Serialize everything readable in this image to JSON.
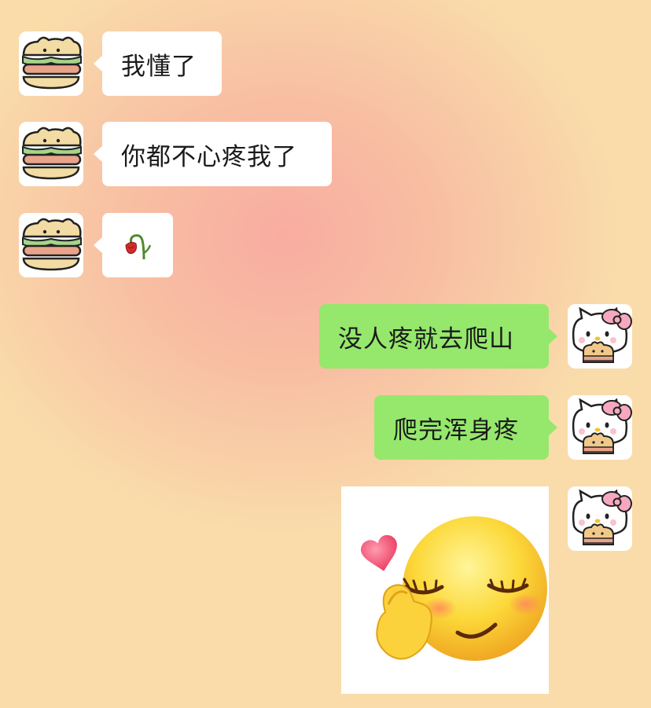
{
  "messages": [
    {
      "side": "left",
      "text": "我懂了",
      "avatar": "bear-sandwich-avatar"
    },
    {
      "side": "left",
      "text": "你都不心疼我了",
      "avatar": "bear-sandwich-avatar"
    },
    {
      "side": "left",
      "emoji": "🥀",
      "avatar": "bear-sandwich-avatar"
    },
    {
      "side": "right",
      "text": "没人疼就去爬山",
      "avatar": "hello-kitty-avatar"
    },
    {
      "side": "right",
      "text": "爬完浑身疼",
      "avatar": "hello-kitty-avatar"
    },
    {
      "side": "right",
      "sticker": "shy-face-finger-heart-sticker",
      "avatar": "hello-kitty-avatar"
    }
  ],
  "colors": {
    "outgoing_bubble": "#95e86c",
    "incoming_bubble": "#ffffff",
    "background_warm": "#f9dcaa",
    "background_glow": "#f8aaa0"
  }
}
